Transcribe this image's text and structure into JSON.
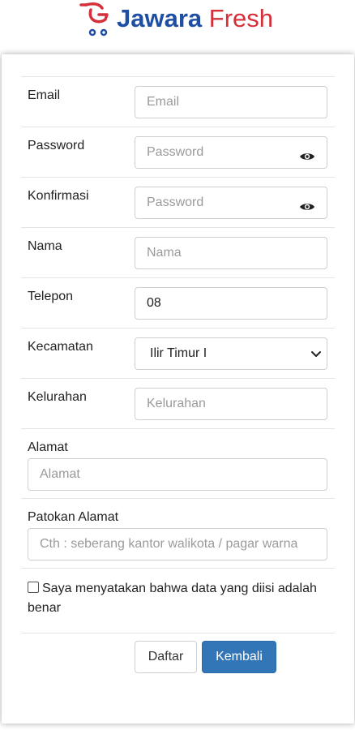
{
  "brand": {
    "name_part1": "Jawara",
    "name_part2": "Fresh",
    "color_primary": "#1f4fa3",
    "color_accent": "#d5303a"
  },
  "form": {
    "email": {
      "label": "Email",
      "placeholder": "Email",
      "value": ""
    },
    "password": {
      "label": "Password",
      "placeholder": "Password",
      "value": ""
    },
    "confirm": {
      "label": "Konfirmasi",
      "placeholder": "Password",
      "value": ""
    },
    "name": {
      "label": "Nama",
      "placeholder": "Nama",
      "value": ""
    },
    "phone": {
      "label": "Telepon",
      "placeholder": "",
      "value": "08"
    },
    "district": {
      "label": "Kecamatan",
      "selected": "Ilir Timur I"
    },
    "village": {
      "label": "Kelurahan",
      "placeholder": "Kelurahan",
      "value": ""
    },
    "address": {
      "label": "Alamat",
      "placeholder": "Alamat",
      "value": ""
    },
    "landmark": {
      "label": "Patokan Alamat",
      "placeholder": "Cth : seberang kantor walikota / pagar warna",
      "value": ""
    },
    "agreement": {
      "text": "Saya menyatakan bahwa data yang diisi adalah benar",
      "checked": false
    }
  },
  "buttons": {
    "submit": "Daftar",
    "back": "Kembali"
  },
  "icons": {
    "password_toggle": "eye-icon",
    "select_arrow": "chevron-down-icon",
    "logo": "cart-logo-icon"
  }
}
